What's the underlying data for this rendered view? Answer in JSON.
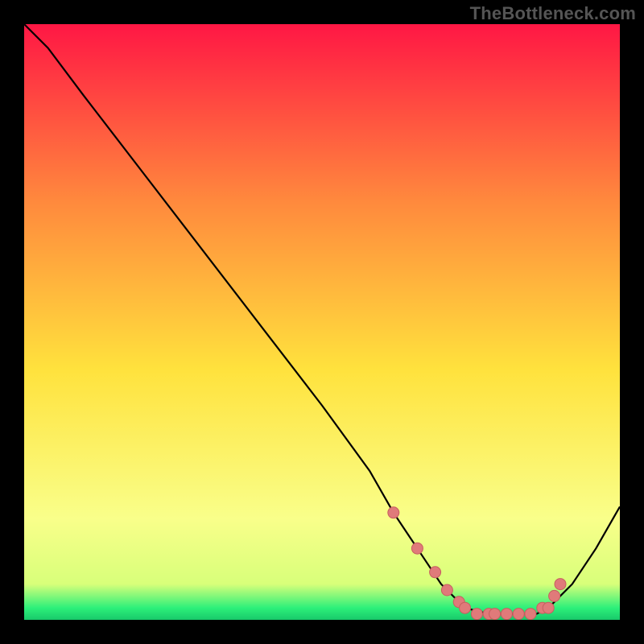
{
  "watermark": "TheBottleneck.com",
  "colors": {
    "bg": "#000000",
    "curve": "#000000",
    "marker_fill": "#e07a7a",
    "marker_stroke": "#c75f5f",
    "grad_top": "#ff1744",
    "grad_mid1": "#ff8a3d",
    "grad_mid2": "#ffe23d",
    "grad_low": "#f9ff8a",
    "grad_green": "#2df07a"
  },
  "chart_data": {
    "type": "line",
    "title": "",
    "xlabel": "",
    "ylabel": "",
    "xlim": [
      0,
      100
    ],
    "ylim": [
      0,
      100
    ],
    "grid": false,
    "legend": false,
    "series": [
      {
        "name": "bottleneck-curve",
        "x": [
          0,
          4,
          10,
          20,
          30,
          40,
          50,
          58,
          62,
          66,
          70,
          74,
          78,
          82,
          86,
          88,
          92,
          96,
          100
        ],
        "y": [
          100,
          96,
          88,
          75,
          62,
          49,
          36,
          25,
          18,
          12,
          6,
          2,
          1,
          1,
          1,
          2,
          6,
          12,
          19
        ]
      }
    ],
    "markers": {
      "name": "highlighted-points",
      "x": [
        62,
        66,
        69,
        71,
        73,
        74,
        76,
        78,
        79,
        81,
        83,
        85,
        87,
        88,
        89,
        90
      ],
      "y": [
        18,
        12,
        8,
        5,
        3,
        2,
        1,
        1,
        1,
        1,
        1,
        1,
        2,
        2,
        4,
        6
      ]
    }
  }
}
